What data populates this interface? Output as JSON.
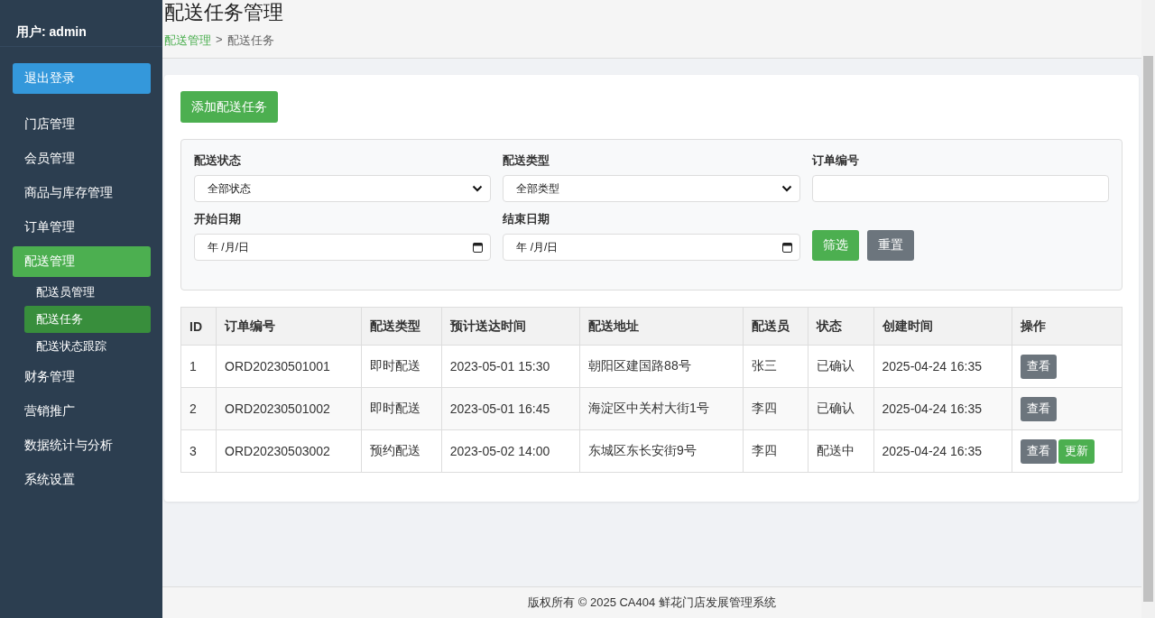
{
  "sidebar": {
    "user": "用户: admin",
    "logout": "退出登录",
    "items": [
      {
        "label": "门店管理",
        "selected": false
      },
      {
        "label": "会员管理",
        "selected": false
      },
      {
        "label": "商品与库存管理",
        "selected": false
      },
      {
        "label": "订单管理",
        "selected": false
      },
      {
        "label": "配送管理",
        "selected": true,
        "children": [
          {
            "label": "配送员管理",
            "selected": false
          },
          {
            "label": "配送任务",
            "selected": true
          },
          {
            "label": "配送状态跟踪",
            "selected": false
          }
        ]
      },
      {
        "label": "财务管理",
        "selected": false
      },
      {
        "label": "营销推广",
        "selected": false
      },
      {
        "label": "数据统计与分析",
        "selected": false
      },
      {
        "label": "系统设置",
        "selected": false
      }
    ]
  },
  "page": {
    "title": "配送任务管理",
    "breadcrumb": [
      "配送管理",
      "配送任务"
    ],
    "breadcrumb_separator": ">"
  },
  "add_button": "添加配送任务",
  "filters": {
    "fields": [
      {
        "kind": "select",
        "label": "配送状态",
        "value": "全部状态"
      },
      {
        "kind": "select",
        "label": "配送类型",
        "value": "全部类型"
      },
      {
        "kind": "text",
        "label": "订单编号"
      },
      {
        "kind": "date",
        "label": "开始日期",
        "value": "年 /月/日"
      },
      {
        "kind": "date",
        "label": "结束日期",
        "value": "年 /月/日"
      }
    ],
    "filter_button": "筛选",
    "reset_button": "重置"
  },
  "table": {
    "columns": [
      "ID",
      "订单编号",
      "配送类型",
      "预计送达时间",
      "配送地址",
      "配送员",
      "状态",
      "创建时间",
      "操作"
    ],
    "rows": [
      {
        "cells": [
          "1",
          "ORD20230501001",
          "即时配送",
          "2023-05-01 15:30",
          "朝阳区建国路88号",
          "张三",
          "已确认",
          "2025-04-24 16:35"
        ],
        "actions": [
          {
            "kind": "view",
            "label": "查看"
          }
        ]
      },
      {
        "cells": [
          "2",
          "ORD20230501002",
          "即时配送",
          "2023-05-01 16:45",
          "海淀区中关村大街1号",
          "李四",
          "已确认",
          "2025-04-24 16:35"
        ],
        "actions": [
          {
            "kind": "view",
            "label": "查看"
          }
        ]
      },
      {
        "cells": [
          "3",
          "ORD20230503002",
          "预约配送",
          "2023-05-02 14:00",
          "东城区东长安街9号",
          "李四",
          "配送中",
          "2025-04-24 16:35"
        ],
        "actions": [
          {
            "kind": "view",
            "label": "查看"
          },
          {
            "kind": "update",
            "label": "更新"
          }
        ]
      }
    ]
  },
  "footer": "版权所有 © 2025 CA404 鲜花门店发展管理系统"
}
